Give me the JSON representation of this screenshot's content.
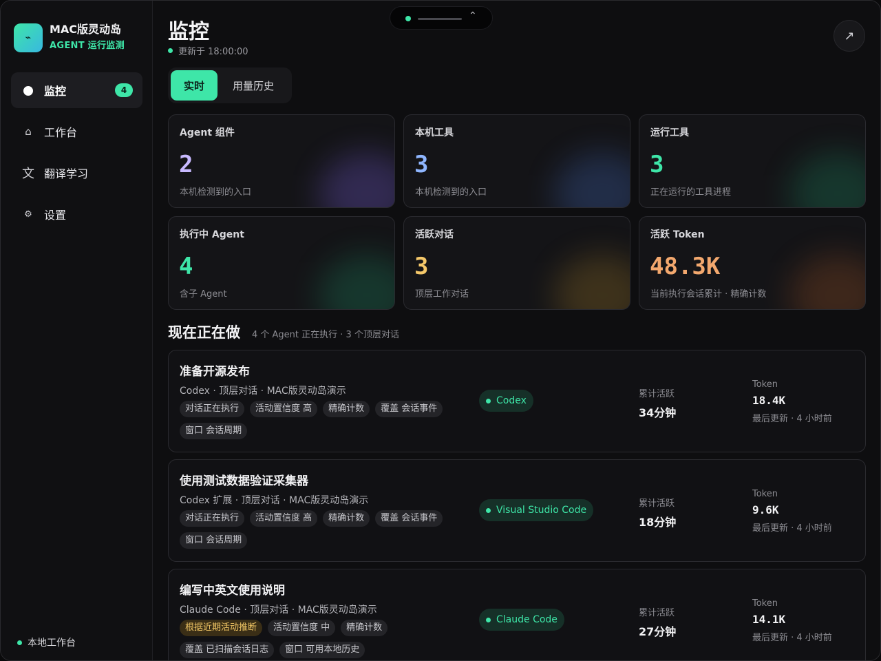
{
  "sidebar": {
    "brand_title": "MAC版灵动岛",
    "brand_subtitle": "AGENT 运行监测",
    "items": [
      {
        "label": "监控",
        "icon": "dot-icon",
        "badge": "4",
        "active": true
      },
      {
        "label": "工作台",
        "icon": "home-icon",
        "glyph": "⌂"
      },
      {
        "label": "翻译学习",
        "icon": "translate-icon",
        "glyph": "文"
      },
      {
        "label": "设置",
        "icon": "gear-icon",
        "glyph": "⚙"
      }
    ],
    "footer": "本地工作台"
  },
  "header": {
    "title": "监控",
    "updated": "更新于 18:00:00"
  },
  "tabs": [
    "实时",
    "用量历史"
  ],
  "stats": [
    {
      "label": "Agent 组件",
      "value": "2",
      "sub": "本机检测到的入口",
      "color": "#c8b9ff"
    },
    {
      "label": "本机工具",
      "value": "3",
      "sub": "本机检测到的入口",
      "color": "#8fb6ff"
    },
    {
      "label": "运行工具",
      "value": "3",
      "sub": "正在运行的工具进程",
      "color": "#3ee6a8"
    },
    {
      "label": "执行中 Agent",
      "value": "4",
      "sub": "含子 Agent",
      "color": "#3ee6a8"
    },
    {
      "label": "活跃对话",
      "value": "3",
      "sub": "顶层工作对话",
      "color": "#f5c86a"
    },
    {
      "label": "活跃 Token",
      "value": "48.3K",
      "sub": "当前执行会话累计 · 精确计数",
      "color": "#f3a86e"
    }
  ],
  "section": {
    "title": "现在正在做",
    "subtitle": "4 个 Agent 正在执行 · 3 个顶层对话"
  },
  "tasks": [
    {
      "title": "准备开源发布",
      "meta": "Codex · 顶层对话 · MAC版灵动岛演示",
      "tags": [
        {
          "text": "对话正在执行"
        },
        {
          "text": "活动置信度 高"
        },
        {
          "text": "精确计数"
        },
        {
          "text": "覆盖 会话事件"
        },
        {
          "text": "窗口 会话周期"
        }
      ],
      "tool": "Codex",
      "activity_label": "累计活跃",
      "activity": "34分钟",
      "token_label": "Token",
      "token": "18.4K",
      "updated": "最后更新 · 4 小时前"
    },
    {
      "title": "使用测试数据验证采集器",
      "meta": "Codex 扩展 · 顶层对话 · MAC版灵动岛演示",
      "tags": [
        {
          "text": "对话正在执行"
        },
        {
          "text": "活动置信度 高"
        },
        {
          "text": "精确计数"
        },
        {
          "text": "覆盖 会话事件"
        },
        {
          "text": "窗口 会话周期"
        }
      ],
      "tool": "Visual Studio Code",
      "activity_label": "累计活跃",
      "activity": "18分钟",
      "token_label": "Token",
      "token": "9.6K",
      "updated": "最后更新 · 4 小时前"
    },
    {
      "title": "编写中英文使用说明",
      "meta": "Claude Code · 顶层对话 · MAC版灵动岛演示",
      "tags": [
        {
          "text": "根据近期活动推断",
          "warn": true
        },
        {
          "text": "活动置信度 中"
        },
        {
          "text": "精确计数"
        },
        {
          "text": "覆盖 已扫描会话日志"
        },
        {
          "text": "窗口 可用本地历史"
        }
      ],
      "tool": "Claude Code",
      "activity_label": "累计活跃",
      "activity": "27分钟",
      "token_label": "Token",
      "token": "14.1K",
      "updated": "最后更新 · 4 小时前"
    }
  ]
}
